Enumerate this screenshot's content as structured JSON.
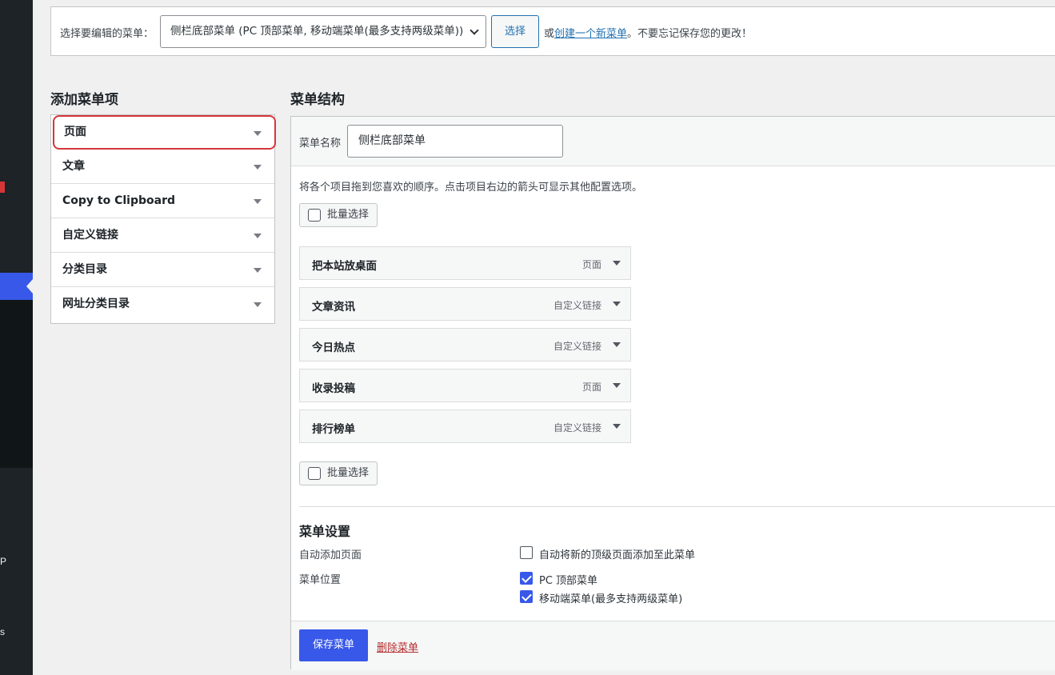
{
  "colors": {
    "accent": "#3858e9",
    "link": "#2271b1",
    "danger": "#b32d2e",
    "highlight_border": "#d63638"
  },
  "sidebar": {
    "fragments": [
      "P",
      "s"
    ]
  },
  "manage": {
    "select_label": "选择要编辑的菜单：",
    "selected_menu": "侧栏底部菜单 (PC 顶部菜单, 移动端菜单(最多支持两级菜单))",
    "select_button": "选择",
    "hint_prefix": "或",
    "hint_link": "创建一个新菜单",
    "hint_suffix": "。不要忘记保存您的更改！"
  },
  "add_items": {
    "title": "添加菜单项",
    "panels": [
      "页面",
      "文章",
      "Copy to Clipboard",
      "自定义链接",
      "分类目录",
      "网址分类目录"
    ]
  },
  "structure": {
    "title": "菜单结构",
    "name_label": "菜单名称",
    "name_value": "侧栏底部菜单",
    "instructions": "将各个项目拖到您喜欢的顺序。点击项目右边的箭头可显示其他配置选项。",
    "bulk_select": "批量选择",
    "items": [
      {
        "title": "把本站放桌面",
        "type": "页面"
      },
      {
        "title": "文章资讯",
        "type": "自定义链接"
      },
      {
        "title": "今日热点",
        "type": "自定义链接"
      },
      {
        "title": "收录投稿",
        "type": "页面"
      },
      {
        "title": "排行榜单",
        "type": "自定义链接"
      }
    ]
  },
  "settings": {
    "title": "菜单设置",
    "auto_add_label": "自动添加页面",
    "auto_add_option": "自动将新的顶级页面添加至此菜单",
    "auto_add_checked": false,
    "location_label": "菜单位置",
    "locations": [
      {
        "label": "PC 顶部菜单",
        "checked": true
      },
      {
        "label": "移动端菜单(最多支持两级菜单)",
        "checked": true
      }
    ]
  },
  "footer": {
    "save": "保存菜单",
    "delete": "删除菜单"
  }
}
